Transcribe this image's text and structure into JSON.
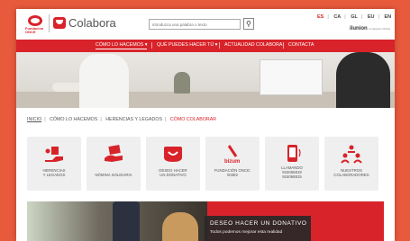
{
  "header": {
    "brand_left": "Fundación",
    "brand_left_bold": "ONCE",
    "brand": "Colabora",
    "search_placeholder": "introduzca una palabra o texto",
    "search_icon": "search-icon",
    "languages": [
      {
        "code": "ES",
        "active": true
      },
      {
        "code": "CA",
        "active": false
      },
      {
        "code": "GL",
        "active": false
      },
      {
        "code": "EU",
        "active": false
      },
      {
        "code": "EN",
        "active": false
      }
    ],
    "partner_logo": "ilunion",
    "partner_sub": "Fundación ONCE"
  },
  "nav": {
    "items": [
      {
        "label": "CÓMO LO HACEMOS ▾",
        "active": true
      },
      {
        "label": "QUÉ PUEDES HACER TÚ ▾",
        "active": false
      },
      {
        "label": "ACTUALIDAD COLABORA",
        "active": false
      },
      {
        "label": "CONTACTA",
        "active": false
      }
    ]
  },
  "breadcrumb": {
    "items": [
      "INICIO",
      "CÓMO LO HACEMOS",
      "HERENCIAS Y LEGADOS",
      "CÓMO COLABORAR"
    ]
  },
  "tiles": [
    {
      "label": "HERENCIAS\nY LEGADOS",
      "icon": "inheritance-icon"
    },
    {
      "label": "NÓMINA SOLIDARIA",
      "icon": "payroll-icon"
    },
    {
      "label": "DESEO HACER\nUN DONATIVO",
      "icon": "donation-smile-icon"
    },
    {
      "label": "FUNDACIÓN ONCE:\n00382",
      "icon": "bizum-icon"
    },
    {
      "label": "LLAMANDO\n915068818\n915068815",
      "icon": "phone-icon"
    },
    {
      "label": "NUESTROS\nCOLABORADORES",
      "icon": "collaborators-icon"
    }
  ],
  "bizum_text": "bizum",
  "banner": {
    "title": "DESEO HACER UN DONATIVO",
    "subtitle": "Todos podemos mejorar esta realidad"
  },
  "colors": {
    "brand_red": "#d8232a",
    "background": "#e85a3c",
    "tile_bg": "#efefef"
  }
}
